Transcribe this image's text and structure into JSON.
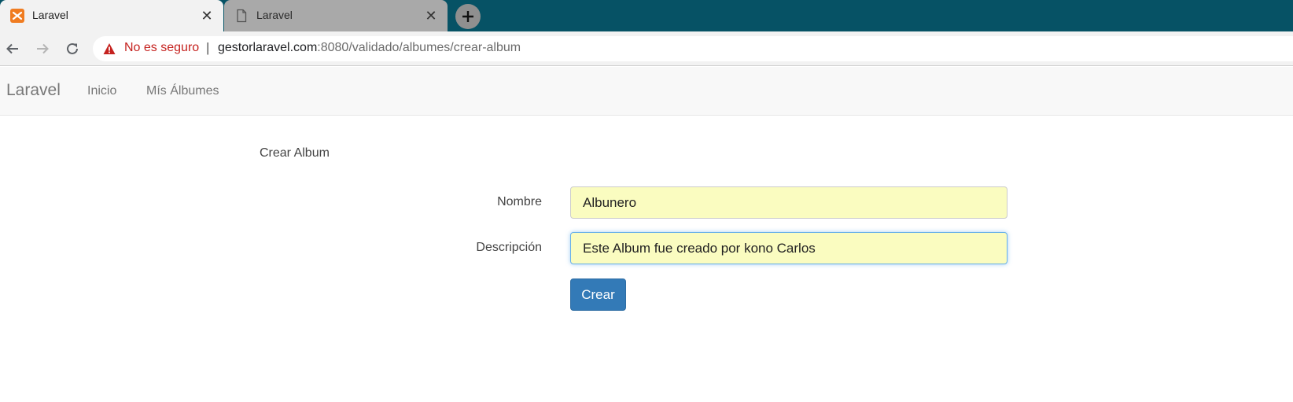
{
  "browser": {
    "tabs": [
      {
        "title": "Laravel",
        "active": true,
        "icon": "xampp-icon"
      },
      {
        "title": "Laravel",
        "active": false,
        "icon": "page-icon"
      }
    ],
    "tab_close_glyph": "✕",
    "new_tab_icon": "plus-icon",
    "security_label": "No es seguro",
    "url_separator": "|",
    "url_host": "gestorlaravel.com",
    "url_rest": ":8080/validado/albumes/crear-album",
    "colors": {
      "tabstrip": "#065265",
      "security_warning": "#c5221f"
    }
  },
  "navbar": {
    "brand": "Laravel",
    "links": [
      {
        "label": "Inicio"
      },
      {
        "label": "Mís Álbumes"
      }
    ]
  },
  "form": {
    "heading": "Crear Album",
    "fields": [
      {
        "label": "Nombre",
        "value": "Albunero"
      },
      {
        "label": "Descripción",
        "value": "Este Album fue creado por kono Carlos"
      }
    ],
    "submit_label": "Crear",
    "colors": {
      "input_autofill": "#fafcc0",
      "button_primary": "#337ab7"
    }
  }
}
